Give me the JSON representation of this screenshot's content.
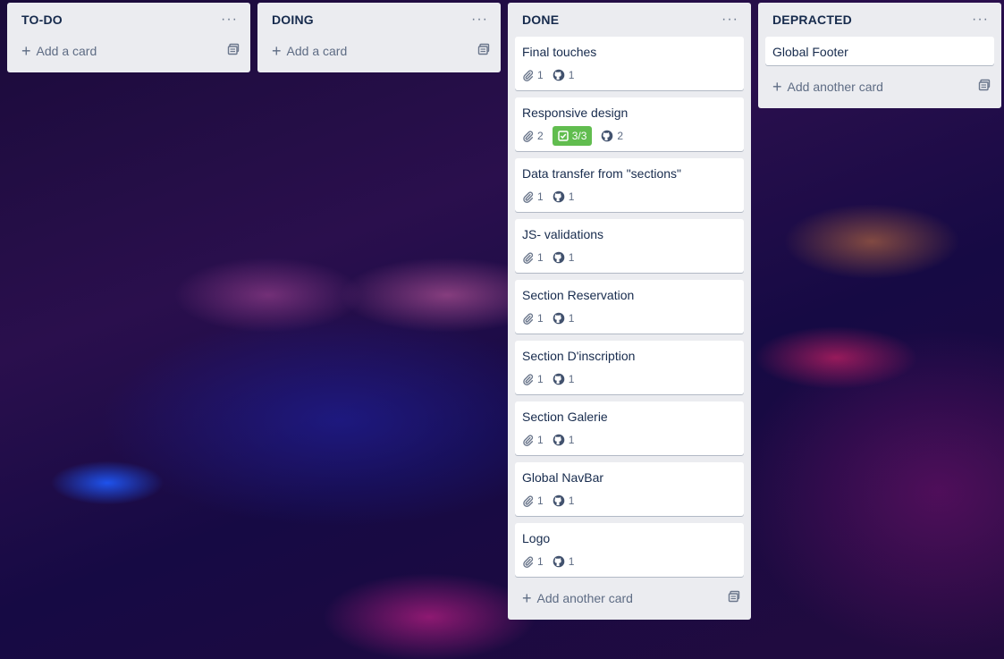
{
  "lists": [
    {
      "title": "TO-DO",
      "menu": "···",
      "add_label": "Add a card",
      "cards": []
    },
    {
      "title": "DOING",
      "menu": "···",
      "add_label": "Add a card",
      "cards": []
    },
    {
      "title": "DONE",
      "menu": "···",
      "add_label": "Add another card",
      "cards": [
        {
          "title": "Final touches",
          "attachments": "1",
          "github": "1"
        },
        {
          "title": "Responsive design",
          "attachments": "2",
          "checklist": "3/3",
          "github": "2"
        },
        {
          "title": "Data transfer from \"sections\"",
          "attachments": "1",
          "github": "1"
        },
        {
          "title": "JS- validations",
          "attachments": "1",
          "github": "1"
        },
        {
          "title": "Section Reservation",
          "attachments": "1",
          "github": "1"
        },
        {
          "title": "Section D'inscription",
          "attachments": "1",
          "github": "1"
        },
        {
          "title": "Section Galerie",
          "attachments": "1",
          "github": "1"
        },
        {
          "title": "Global NavBar",
          "attachments": "1",
          "github": "1"
        },
        {
          "title": "Logo",
          "attachments": "1",
          "github": "1"
        }
      ]
    },
    {
      "title": "DEPRACTED",
      "menu": "···",
      "add_label": "Add another card",
      "cards": [
        {
          "title": "Global Footer"
        }
      ]
    }
  ],
  "icons": {
    "menu": "more-horizontal-icon",
    "add": "plus-icon",
    "template": "card-template-icon",
    "attachment": "paperclip-icon",
    "checklist": "checkbox-icon",
    "github": "github-icon"
  },
  "colors": {
    "list_bg": "#ebecf0",
    "card_bg": "#ffffff",
    "checklist_complete": "#61bd4f",
    "title_text": "#172b4d",
    "muted_text": "#5e6c84"
  }
}
